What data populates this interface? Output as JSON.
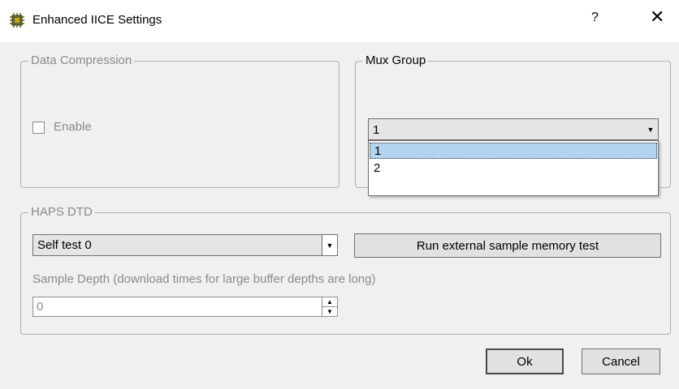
{
  "window": {
    "title": "Enhanced IICE Settings",
    "help_label": "?",
    "close_label": "✕",
    "icon": "chip-icon"
  },
  "data_compression": {
    "legend": "Data Compression",
    "enable_label": "Enable",
    "enabled": false
  },
  "mux_group": {
    "legend": "Mux Group",
    "selected": "1",
    "options": [
      "1",
      "2"
    ]
  },
  "haps_dtd": {
    "legend": "HAPS DTD",
    "self_test_selected": "Self test 0",
    "run_test_label": "Run external sample memory test",
    "sample_depth_label": "Sample Depth (download times for large buffer depths are long)",
    "sample_depth_value": "0"
  },
  "buttons": {
    "ok_label": "Ok",
    "cancel_label": "Cancel"
  }
}
